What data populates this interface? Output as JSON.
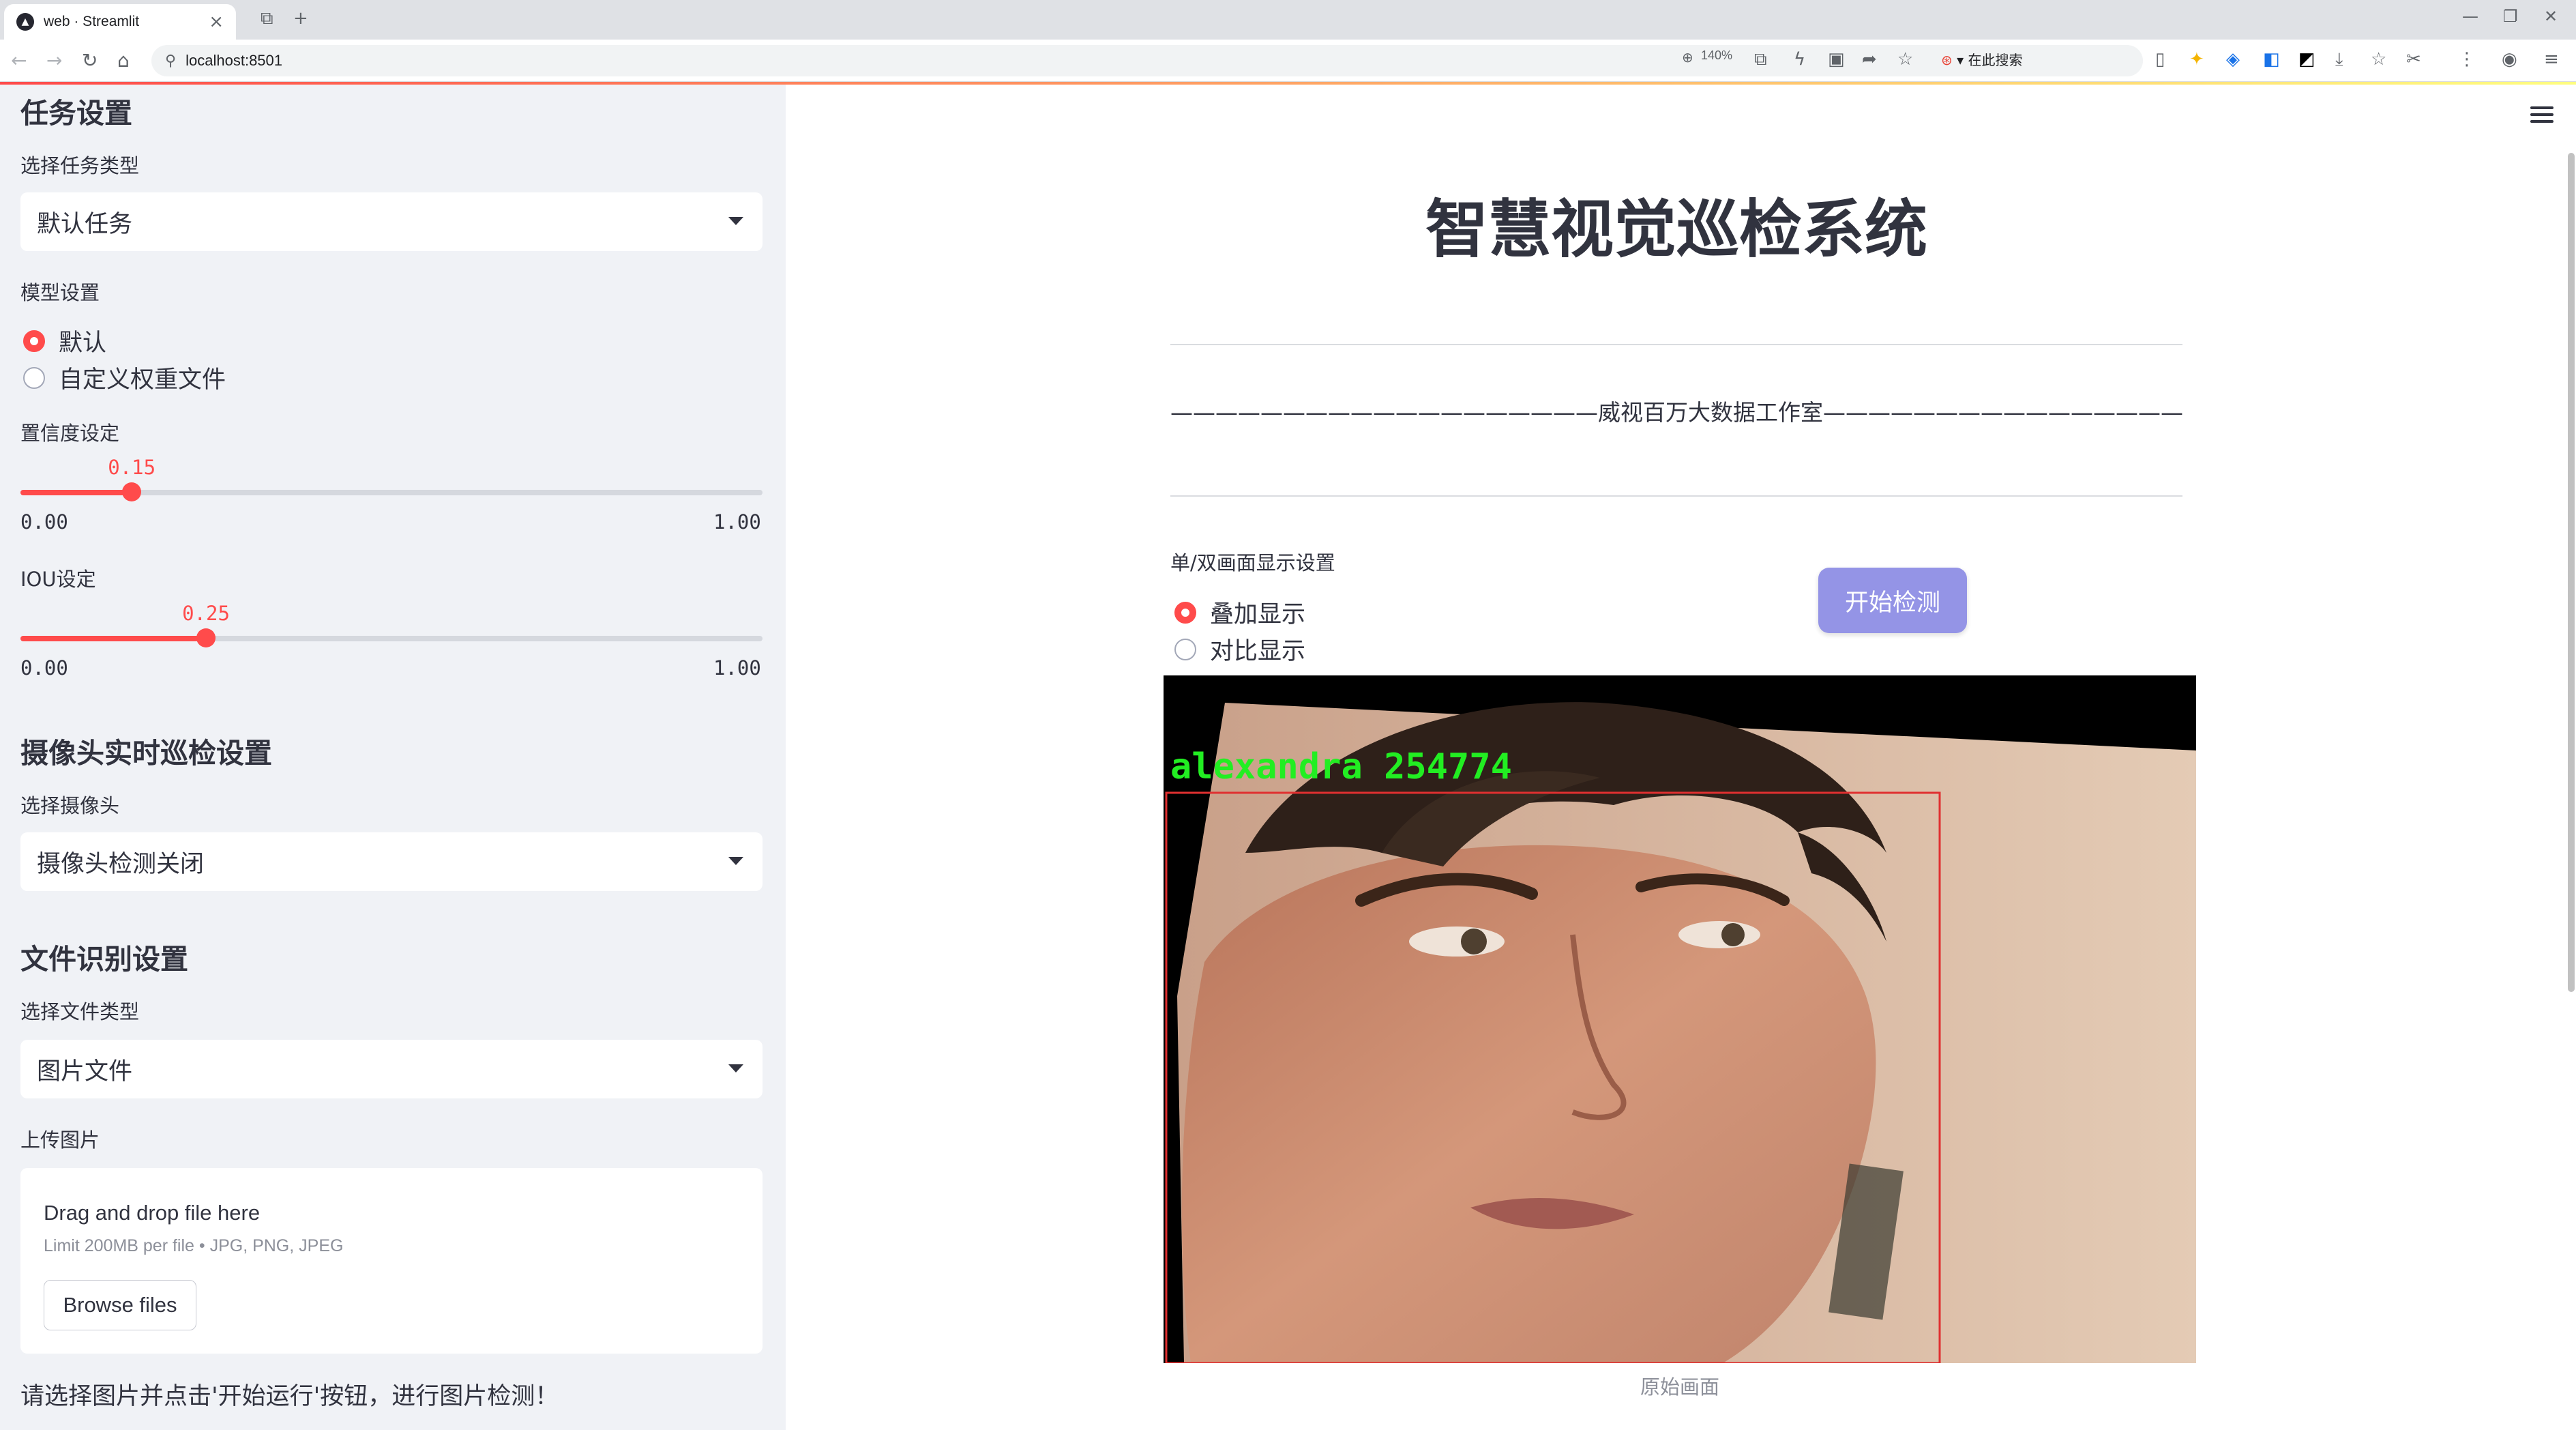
{
  "browser": {
    "tab_title": "web · Streamlit",
    "url": "localhost:8501",
    "zoom": "140%",
    "search_placeholder": "在此搜索"
  },
  "sidebar": {
    "task_header": "任务设置",
    "task_type_label": "选择任务类型",
    "task_type_value": "默认任务",
    "model_label": "模型设置",
    "model_options": [
      "默认",
      "自定义权重文件"
    ],
    "model_selected": "默认",
    "confidence": {
      "label": "置信度设定",
      "value": "0.15",
      "min": "0.00",
      "max": "1.00",
      "fraction": 0.15
    },
    "iou": {
      "label": "IOU设定",
      "value": "0.25",
      "min": "0.00",
      "max": "1.00",
      "fraction": 0.25
    },
    "camera_header": "摄像头实时巡检设置",
    "camera_label": "选择摄像头",
    "camera_value": "摄像头检测关闭",
    "file_header": "文件识别设置",
    "file_type_label": "选择文件类型",
    "file_type_value": "图片文件",
    "upload_label": "上传图片",
    "upload_title": "Drag and drop file here",
    "upload_limit": "Limit 200MB per file • JPG, PNG, JPEG",
    "browse_label": "Browse files",
    "hint": "请选择图片并点击'开始运行'按钮，进行图片检测！"
  },
  "main": {
    "title": "智慧视觉巡检系统",
    "studio_line": "———————————————————威视百万大数据工作室—————————————————————",
    "display_label": "单/双画面显示设置",
    "display_options": [
      "叠加显示",
      "对比显示"
    ],
    "display_selected": "叠加显示",
    "start_button": "开始检测",
    "detection_label": "alexandra 254774",
    "caption": "原始画面"
  },
  "colors": {
    "accent": "#ff4b4b",
    "sidebar_bg": "#f0f2f6",
    "button_bg": "#8f8fe5",
    "detection_text": "#22ee22",
    "detection_box": "#e03030"
  }
}
